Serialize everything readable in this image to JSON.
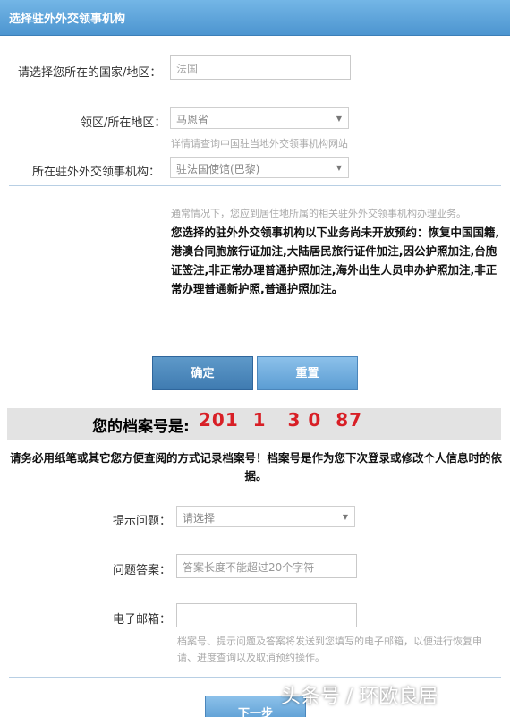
{
  "header": {
    "title": "选择驻外外交领事机构"
  },
  "form": {
    "country_label": "请选择您所在的国家/地区：",
    "country_value": "法国",
    "district_label": "领区/所在地区：",
    "district_value": "马恩省",
    "district_hint": "详情请查询中国驻当地外交领事机构网站",
    "mission_label": "所在驻外外交领事机构：",
    "mission_value": "驻法国使馆(巴黎)"
  },
  "notice": {
    "normal": "通常情况下，您应到居住地所属的相关驻外外交领事机构办理业务。",
    "bold": "您选择的驻外外交领事机构以下业务尚未开放预约：恢复中国国籍,港澳台同胞旅行证加注,大陆居民旅行证件加注,因公护照加注,台胞证签注,非正常办理普通护照加注,海外出生人员申办护照加注,非正常办理普通新护照,普通护照加注。"
  },
  "buttons": {
    "confirm": "确定",
    "reset": "重置",
    "next": "下一步"
  },
  "archive": {
    "label": "您的档案号是:",
    "number": "201  1   3 0  87"
  },
  "warning": "请务必用纸笔或其它您方便查阅的方式记录档案号！档案号是作为您下次登录或修改个人信息时的依据。",
  "security": {
    "question_label": "提示问题：",
    "question_value": "请选择",
    "answer_label": "问题答案：",
    "answer_placeholder": "答案长度不能超过20个字符",
    "email_label": "电子邮箱：",
    "email_hint": "档案号、提示问题及答案将发送到您填写的电子邮箱，以便进行恢复申请、进度查询以及取消预约操作。"
  },
  "watermark": "头条号 / 环欧良居"
}
